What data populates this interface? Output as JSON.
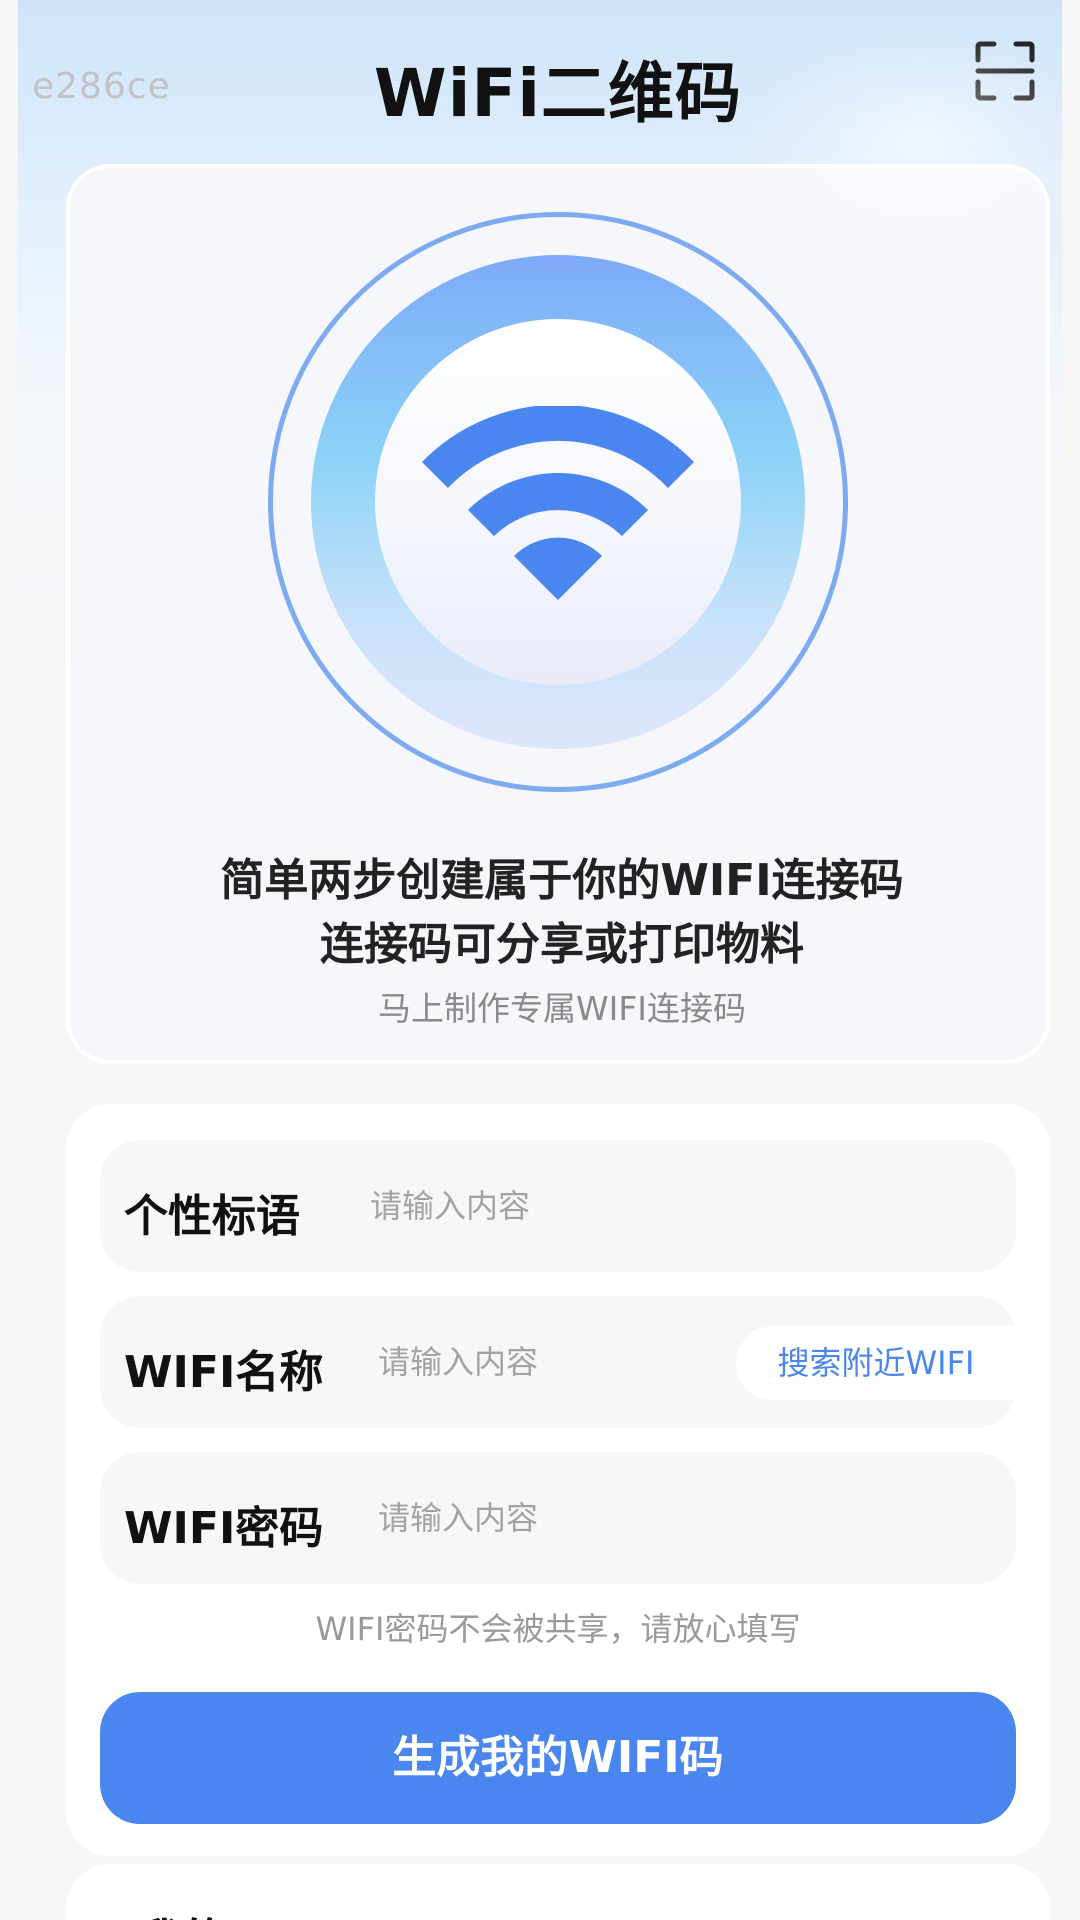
{
  "watermark": "e286ce",
  "header": {
    "title": "WiFi二维码",
    "scan_icon": "scan-icon"
  },
  "hero": {
    "icon": "wifi-icon",
    "line1": "简单两步创建属于你的WIFI连接码",
    "line2": "连接码可分享或打印物料",
    "subtitle": "马上制作专属WIFI连接码"
  },
  "form": {
    "fields": [
      {
        "label": "个性标语",
        "placeholder": "请输入内容",
        "value": ""
      },
      {
        "label": "WIFI名称",
        "placeholder": "请输入内容",
        "value": ""
      },
      {
        "label": "WIFI密码",
        "placeholder": "请输入内容",
        "value": ""
      }
    ],
    "search_nearby_label": "搜索附近WIFI",
    "hint": "WIFI密码不会被共享，请放心填写",
    "submit_label": "生成我的WIFI码"
  },
  "my_wifi": {
    "title": "我的WIFI"
  },
  "colors": {
    "accent": "#4a86f0",
    "accent_text": "#4a86ee",
    "ring": "#7eaaf2"
  }
}
